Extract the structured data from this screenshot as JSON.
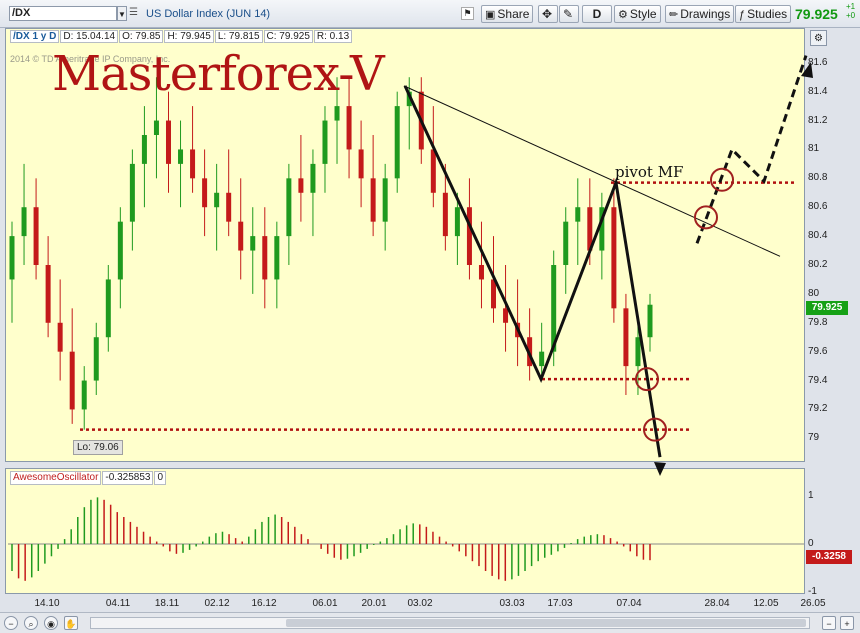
{
  "toolbar": {
    "symbol": "/DX",
    "instrument": "US Dollar Index (JUN 14)",
    "share_label": "Share",
    "drawing_set_label": "D",
    "style_label": "Style",
    "drawings_label": "Drawings",
    "studies_label": "Studies",
    "last_price": "79.925",
    "change_up": "+1",
    "change_dn": "+0"
  },
  "info": {
    "symbol_period": "/DX 1 y D",
    "date": "D: 15.04.14",
    "open": "O: 79.85",
    "high": "H: 79.945",
    "low": "L: 79.815",
    "close": "C: 79.925",
    "range": "R: 0.13"
  },
  "copyright": "2014 © TD Ameritrade IP Company, Inc.",
  "watermark": "Masterforex-V",
  "lo_label": "Lo: 79.06",
  "oscillator": {
    "name": "AwesomeOscillator",
    "value": "-0.325853",
    "param": "0",
    "tag": "-0.3258",
    "axis": [
      "1",
      "0",
      "-1"
    ]
  },
  "colors": {
    "bull": "#1f9a1f",
    "bear": "#c41a1a",
    "panel_bg": "#ffffcc",
    "level_line": "#b01010",
    "watermark": "#b01414"
  },
  "annotations": {
    "pivot_label": "pivot MF"
  },
  "chart_data": {
    "type": "candlestick",
    "ylim": [
      78.85,
      81.73
    ],
    "ytick_labels": [
      "81.6",
      "81.4",
      "81.2",
      "81",
      "80.8",
      "80.6",
      "80.4",
      "80.2",
      "80",
      "79.8",
      "79.6",
      "79.4",
      "79.2",
      "79"
    ],
    "x_tick_labels": [
      "14.10",
      "04.11",
      "18.11",
      "02.12",
      "16.12",
      "06.01",
      "20.01",
      "03.02",
      "03.03",
      "17.03",
      "07.04",
      "28.04",
      "12.05",
      "26.05"
    ],
    "last_price": 79.925,
    "low": 79.06,
    "pattern_points": [
      {
        "date": "03.02",
        "price": 81.44
      },
      {
        "date": "17.03",
        "price": 79.41
      },
      {
        "date": "07.04",
        "price": 80.77
      },
      {
        "date": "14.04",
        "price": 78.87
      }
    ],
    "forecast_points": [
      {
        "date": "28.04",
        "price": 80.35
      },
      {
        "date": "05.05",
        "price": 81.0
      },
      {
        "date": "12.05",
        "price": 80.78
      },
      {
        "date": "26.05",
        "price": 81.65
      }
    ],
    "trend_line": [
      {
        "date": "03.02",
        "price": 81.44
      },
      {
        "date": "26.05",
        "price": 80.26
      }
    ],
    "levels": [
      {
        "price": 80.77,
        "from": "07.04",
        "to": "26.05"
      },
      {
        "price": 79.41,
        "from": "17.03",
        "to": "14.04"
      },
      {
        "price": 79.06,
        "from": "14.10",
        "to": "14.04"
      }
    ],
    "circle_marks": [
      {
        "date": "28.04",
        "price": 80.53
      },
      {
        "date": "28.04",
        "price": 80.79
      },
      {
        "date": "07.04",
        "price": 79.41
      },
      {
        "date": "14.04",
        "price": 79.06
      }
    ],
    "candles": [
      [
        80.1,
        80.5,
        79.8,
        80.4
      ],
      [
        80.4,
        80.9,
        80.2,
        80.6
      ],
      [
        80.6,
        80.8,
        80.1,
        80.2
      ],
      [
        80.2,
        80.4,
        79.7,
        79.8
      ],
      [
        79.8,
        80.1,
        79.4,
        79.6
      ],
      [
        79.6,
        79.9,
        79.1,
        79.2
      ],
      [
        79.2,
        79.5,
        79.06,
        79.4
      ],
      [
        79.4,
        79.8,
        79.3,
        79.7
      ],
      [
        79.7,
        80.2,
        79.6,
        80.1
      ],
      [
        80.1,
        80.6,
        79.9,
        80.5
      ],
      [
        80.5,
        81.0,
        80.3,
        80.9
      ],
      [
        80.9,
        81.3,
        80.6,
        81.1
      ],
      [
        81.1,
        81.5,
        80.8,
        81.2
      ],
      [
        81.2,
        81.4,
        80.7,
        80.9
      ],
      [
        80.9,
        81.2,
        80.6,
        81.0
      ],
      [
        81.0,
        81.3,
        80.7,
        80.8
      ],
      [
        80.8,
        81.0,
        80.4,
        80.6
      ],
      [
        80.6,
        80.9,
        80.3,
        80.7
      ],
      [
        80.7,
        81.0,
        80.4,
        80.5
      ],
      [
        80.5,
        80.8,
        80.1,
        80.3
      ],
      [
        80.3,
        80.6,
        80.0,
        80.4
      ],
      [
        80.4,
        80.6,
        79.9,
        80.1
      ],
      [
        80.1,
        80.5,
        79.9,
        80.4
      ],
      [
        80.4,
        80.9,
        80.2,
        80.8
      ],
      [
        80.8,
        81.1,
        80.5,
        80.7
      ],
      [
        80.7,
        81.0,
        80.4,
        80.9
      ],
      [
        80.9,
        81.3,
        80.7,
        81.2
      ],
      [
        81.2,
        81.5,
        80.9,
        81.3
      ],
      [
        81.3,
        81.5,
        80.8,
        81.0
      ],
      [
        81.0,
        81.2,
        80.6,
        80.8
      ],
      [
        80.8,
        81.1,
        80.4,
        80.5
      ],
      [
        80.5,
        80.9,
        80.3,
        80.8
      ],
      [
        80.8,
        81.4,
        80.7,
        81.3
      ],
      [
        81.3,
        81.5,
        81.0,
        81.4
      ],
      [
        81.4,
        81.5,
        80.9,
        81.0
      ],
      [
        81.0,
        81.3,
        80.6,
        80.7
      ],
      [
        80.7,
        80.9,
        80.3,
        80.4
      ],
      [
        80.4,
        80.7,
        80.2,
        80.6
      ],
      [
        80.6,
        80.8,
        80.1,
        80.2
      ],
      [
        80.2,
        80.5,
        79.9,
        80.1
      ],
      [
        80.1,
        80.4,
        79.8,
        79.9
      ],
      [
        79.9,
        80.2,
        79.6,
        79.8
      ],
      [
        79.8,
        80.1,
        79.5,
        79.7
      ],
      [
        79.7,
        79.9,
        79.4,
        79.5
      ],
      [
        79.5,
        79.8,
        79.4,
        79.6
      ],
      [
        79.6,
        80.3,
        79.5,
        80.2
      ],
      [
        80.2,
        80.6,
        80.0,
        80.5
      ],
      [
        80.5,
        80.8,
        80.2,
        80.6
      ],
      [
        80.6,
        80.8,
        80.2,
        80.3
      ],
      [
        80.3,
        80.7,
        80.1,
        80.6
      ],
      [
        80.6,
        80.8,
        79.8,
        79.9
      ],
      [
        79.9,
        80.0,
        79.3,
        79.5
      ],
      [
        79.5,
        79.8,
        79.3,
        79.7
      ],
      [
        79.7,
        80.0,
        79.6,
        79.925
      ]
    ],
    "oscillator": {
      "name": "AwesomeOscillator",
      "ylim": [
        -1.1,
        1.1
      ],
      "values": [
        -0.55,
        -0.7,
        -0.75,
        -0.68,
        -0.55,
        -0.4,
        -0.25,
        -0.1,
        0.1,
        0.3,
        0.55,
        0.75,
        0.9,
        0.95,
        0.9,
        0.8,
        0.65,
        0.55,
        0.45,
        0.35,
        0.25,
        0.15,
        0.05,
        -0.05,
        -0.15,
        -0.2,
        -0.18,
        -0.12,
        -0.05,
        0.05,
        0.15,
        0.22,
        0.25,
        0.2,
        0.12,
        0.05,
        0.15,
        0.3,
        0.45,
        0.55,
        0.6,
        0.55,
        0.45,
        0.35,
        0.2,
        0.1,
        0.0,
        -0.1,
        -0.2,
        -0.28,
        -0.32,
        -0.3,
        -0.25,
        -0.18,
        -0.1,
        -0.02,
        0.05,
        0.12,
        0.2,
        0.3,
        0.38,
        0.42,
        0.4,
        0.35,
        0.25,
        0.15,
        0.05,
        -0.05,
        -0.15,
        -0.25,
        -0.35,
        -0.45,
        -0.55,
        -0.65,
        -0.72,
        -0.75,
        -0.72,
        -0.65,
        -0.55,
        -0.45,
        -0.35,
        -0.28,
        -0.22,
        -0.15,
        -0.08,
        0.02,
        0.1,
        0.15,
        0.18,
        0.2,
        0.18,
        0.12,
        0.05,
        -0.05,
        -0.15,
        -0.25,
        -0.32,
        -0.33
      ]
    }
  }
}
